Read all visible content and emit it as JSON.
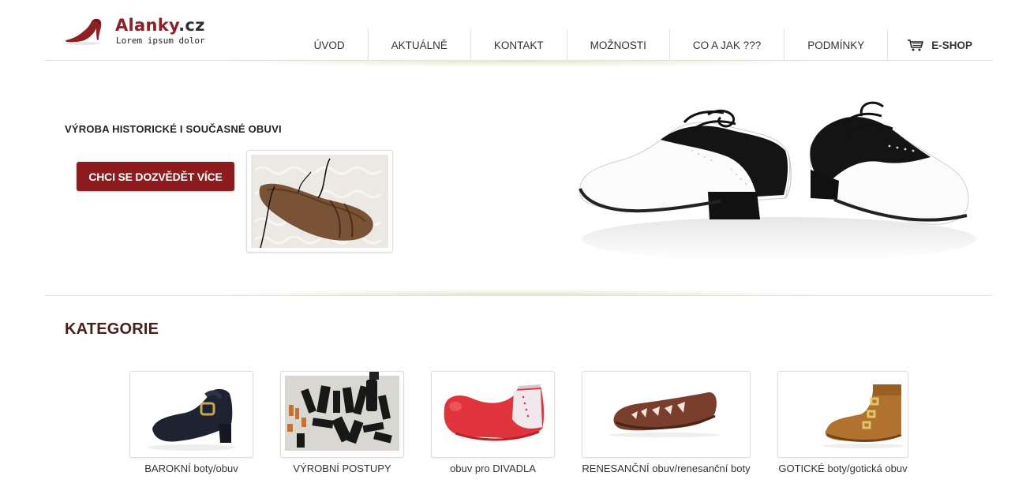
{
  "brand": {
    "name": "Alanky",
    "tld": ".cz",
    "tagline": "Lorem ipsum dolor",
    "icon": "red-high-heel-shoe"
  },
  "nav": {
    "items": [
      "ÚVOD",
      "AKTUÁLNĚ",
      "KONTAKT",
      "MOŽNOSTI",
      "CO A JAK ???",
      "PODMÍNKY"
    ],
    "shop": {
      "label": "E-SHOP",
      "icon": "shopping-cart-icon"
    }
  },
  "hero": {
    "heading": "VÝROBA HISTORICKÉ I SOUČASNÉ OBUVI",
    "cta_label": "CHCI SE DOZVĚDĚT VÍCE",
    "thumb": "brown-leather-sandal",
    "image": "black-white-saddle-shoes"
  },
  "categories": {
    "title": "KATEGORIE",
    "items": [
      {
        "label": "BAROKNÍ boty/obuv",
        "image": "baroque-shoe"
      },
      {
        "label": "VÝROBNÍ POSTUPY",
        "image": "leather-pattern-pieces"
      },
      {
        "label": "obuv pro DIVADLA",
        "image": "red-clown-shoe"
      },
      {
        "label": "RENESANČNÍ obuv/renesanční boty",
        "image": "renaissance-slipper"
      },
      {
        "label": "GOTICKÉ boty/gotická obuv",
        "image": "gothic-buckle-boot"
      }
    ]
  },
  "colors": {
    "accent": "#8e1c1f",
    "heading": "#4a1e1c",
    "glow": "#c6d69e"
  }
}
